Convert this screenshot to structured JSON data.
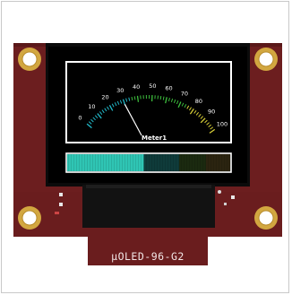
{
  "module": {
    "model_label": "µOLED-96-G2"
  },
  "meter": {
    "label": "Meter1",
    "scale": [
      "0",
      "10",
      "20",
      "30",
      "40",
      "50",
      "60",
      "70",
      "80",
      "90",
      "100"
    ],
    "needle_value": 30,
    "bar_level_percent": 47
  },
  "colors": {
    "pcb": "#6c1e1f",
    "pcb_dark": "#4d1414",
    "gold_pad": "#d2a740",
    "screen": "#000000",
    "meter_border": "#ffffff",
    "bar_fill": "#2fc5b4",
    "bar_dim": "#0f3b3a",
    "tick_cyan": "#21b8c8",
    "tick_green": "#3dbd3d",
    "tick_yellow": "#d8cf38"
  }
}
